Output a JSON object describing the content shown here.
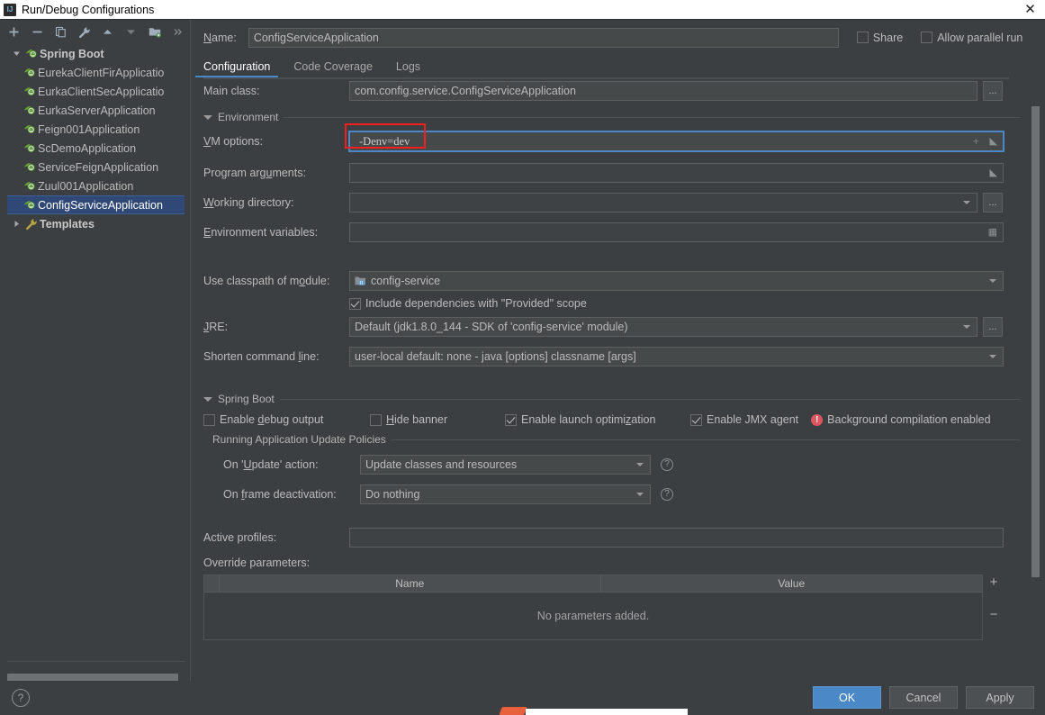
{
  "window": {
    "title": "Run/Debug Configurations",
    "icon": "intellij-idea-icon",
    "close_label": "✕"
  },
  "toolbar": {
    "items": [
      {
        "name": "add-configuration-button",
        "icon": "plus-icon",
        "label": "+"
      },
      {
        "name": "remove-configuration-button",
        "icon": "minus-icon",
        "label": "−"
      },
      {
        "name": "copy-configuration-button",
        "icon": "copy-icon",
        "label": "Copy"
      },
      {
        "name": "edit-templates-button",
        "icon": "wrench-icon",
        "label": "Edit Templates"
      },
      {
        "name": "move-up-button",
        "icon": "arrow-up-icon",
        "label": "Move Up"
      },
      {
        "name": "move-down-button",
        "icon": "arrow-down-icon",
        "label": "Move Down"
      },
      {
        "name": "move-into-folder-button",
        "icon": "folder-add-icon",
        "label": "Move Into New Folder"
      },
      {
        "name": "more-options-button",
        "icon": "chevron-double-right-icon",
        "label": "»"
      }
    ]
  },
  "tree": {
    "group": {
      "label": "Spring Boot",
      "icon": "spring-boot-icon",
      "expanded": true
    },
    "items": [
      {
        "label": "EurekaClientFirApplicatio",
        "icon": "run-config-icon"
      },
      {
        "label": "EurkaClientSecApplicatio",
        "icon": "run-config-icon"
      },
      {
        "label": "EurkaServerApplication",
        "icon": "run-config-icon"
      },
      {
        "label": "Feign001Application",
        "icon": "run-config-icon"
      },
      {
        "label": "ScDemoApplication",
        "icon": "run-config-icon"
      },
      {
        "label": "ServiceFeignApplication",
        "icon": "run-config-icon"
      },
      {
        "label": "Zuul001Application",
        "icon": "run-config-icon"
      },
      {
        "label": "ConfigServiceApplication",
        "icon": "run-config-icon",
        "selected": true
      }
    ],
    "templates": {
      "label": "Templates",
      "icon": "wrench-icon",
      "expanded": false
    }
  },
  "header": {
    "name_label": "Name:",
    "name_value": "ConfigServiceApplication",
    "share_label": "Share",
    "share_checked": false,
    "allow_parallel_label": "Allow parallel run",
    "allow_parallel_checked": false
  },
  "tabs": [
    {
      "label": "Configuration",
      "active": true
    },
    {
      "label": "Code Coverage",
      "active": false
    },
    {
      "label": "Logs",
      "active": false
    }
  ],
  "form": {
    "main_class_label": "Main class:",
    "main_class_value": "com.config.service.ConfigServiceApplication",
    "environment_section": "Environment",
    "vm_options_label": "VM options:",
    "vm_options_value": "-Denv=dev",
    "program_arguments_label": "Program arguments:",
    "program_arguments_value": "",
    "working_directory_label": "Working directory:",
    "working_directory_value": "",
    "environment_variables_label": "Environment variables:",
    "environment_variables_value": "",
    "classpath_label": "Use classpath of module:",
    "classpath_value": "config-service",
    "classpath_icon": "module-icon",
    "include_provided_label": "Include dependencies with \"Provided\" scope",
    "include_provided_checked": true,
    "jre_label": "JRE:",
    "jre_value": "Default (jdk1.8.0_144 - SDK of 'config-service' module)",
    "shorten_label": "Shorten command line:",
    "shorten_value": "user-local default: none - java [options] classname [args]",
    "ellipsis_label": "..."
  },
  "spring_boot": {
    "section_label": "Spring Boot",
    "checks": [
      {
        "label": "Enable debug output",
        "checked": false,
        "name": "enable-debug-output-checkbox"
      },
      {
        "label": "Hide banner",
        "checked": false,
        "name": "hide-banner-checkbox"
      },
      {
        "label": "Enable launch optimization",
        "checked": true,
        "name": "enable-launch-optimization-checkbox"
      },
      {
        "label": "Enable JMX agent",
        "checked": true,
        "name": "enable-jmx-agent-checkbox"
      }
    ],
    "background_compilation": {
      "label": "Background compilation enabled",
      "icon": "warning-icon",
      "icon_glyph": "!",
      "icon_color": "#db5860"
    },
    "policies_label": "Running Application Update Policies",
    "on_update_label": "On 'Update' action:",
    "on_update_value": "Update classes and resources",
    "on_frame_label": "On frame deactivation:",
    "on_frame_value": "Do nothing",
    "help_glyph": "?"
  },
  "profiles": {
    "active_profiles_label": "Active profiles:",
    "active_profiles_value": "",
    "override_parameters_label": "Override parameters:",
    "columns": [
      "Name",
      "Value"
    ],
    "empty_text": "No parameters added.",
    "add_glyph": "+",
    "remove_glyph": "−"
  },
  "footer": {
    "help_glyph": "?",
    "ok_label": "OK",
    "cancel_label": "Cancel",
    "apply_label": "Apply"
  },
  "colors": {
    "background": "#3c3f41",
    "field_background": "#45494a",
    "accent": "#4a88c7",
    "selection": "#2f4875",
    "highlight_box": "#f42020",
    "warning": "#db5860",
    "text": "#bbbbbb"
  }
}
